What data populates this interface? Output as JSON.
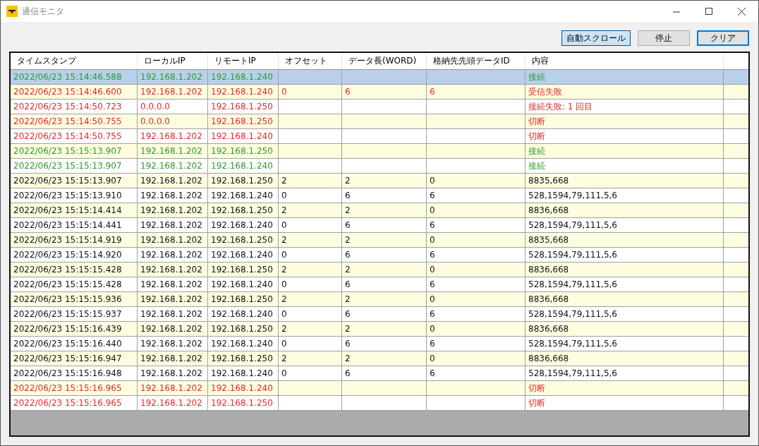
{
  "window": {
    "title": "通信モニタ"
  },
  "buttons": [
    {
      "label": "自動スクロール",
      "pressed": true,
      "focused": false
    },
    {
      "label": "停止",
      "pressed": false,
      "focused": false
    },
    {
      "label": "クリア",
      "pressed": false,
      "focused": true
    }
  ],
  "table": {
    "columns": [
      "タイムスタンプ",
      "ローカルIP",
      "リモートIP",
      "オフセット",
      "データ長(WORD)",
      "格納先先頭データID",
      "内容"
    ],
    "rows": [
      {
        "kind": "connect",
        "selected": true,
        "cells": [
          "2022/06/23 15:14:46.588",
          "192.168.1.202",
          "192.168.1.240",
          null,
          null,
          null,
          "接続"
        ]
      },
      {
        "kind": "error",
        "selected": false,
        "cells": [
          "2022/06/23 15:14:46.600",
          "192.168.1.202",
          "192.168.1.240",
          "0",
          "6",
          "6",
          "受信失敗"
        ]
      },
      {
        "kind": "error",
        "selected": false,
        "cells": [
          "2022/06/23 15:14:50.723",
          "0.0.0.0",
          "192.168.1.250",
          null,
          null,
          null,
          "接続失敗: 1 回目"
        ]
      },
      {
        "kind": "error",
        "selected": false,
        "cells": [
          "2022/06/23 15:14:50.755",
          "0.0.0.0",
          "192.168.1.250",
          null,
          null,
          null,
          "切断"
        ]
      },
      {
        "kind": "error",
        "selected": false,
        "cells": [
          "2022/06/23 15:14:50.755",
          "192.168.1.202",
          "192.168.1.240",
          null,
          null,
          null,
          "切断"
        ]
      },
      {
        "kind": "connect",
        "selected": false,
        "cells": [
          "2022/06/23 15:15:13.907",
          "192.168.1.202",
          "192.168.1.250",
          null,
          null,
          null,
          "接続"
        ]
      },
      {
        "kind": "connect",
        "selected": false,
        "cells": [
          "2022/06/23 15:15:13.907",
          "192.168.1.202",
          "192.168.1.240",
          null,
          null,
          null,
          "接続"
        ]
      },
      {
        "kind": "data",
        "selected": false,
        "cells": [
          "2022/06/23 15:15:13.907",
          "192.168.1.202",
          "192.168.1.250",
          "2",
          "2",
          "0",
          "8835,668"
        ]
      },
      {
        "kind": "data",
        "selected": false,
        "cells": [
          "2022/06/23 15:15:13.910",
          "192.168.1.202",
          "192.168.1.240",
          "0",
          "6",
          "6",
          "528,1594,79,111,5,6"
        ]
      },
      {
        "kind": "data",
        "selected": false,
        "cells": [
          "2022/06/23 15:15:14.414",
          "192.168.1.202",
          "192.168.1.250",
          "2",
          "2",
          "0",
          "8836,668"
        ]
      },
      {
        "kind": "data",
        "selected": false,
        "cells": [
          "2022/06/23 15:15:14.441",
          "192.168.1.202",
          "192.168.1.240",
          "0",
          "6",
          "6",
          "528,1594,79,111,5,6"
        ]
      },
      {
        "kind": "data",
        "selected": false,
        "cells": [
          "2022/06/23 15:15:14.919",
          "192.168.1.202",
          "192.168.1.250",
          "2",
          "2",
          "0",
          "8835,668"
        ]
      },
      {
        "kind": "data",
        "selected": false,
        "cells": [
          "2022/06/23 15:15:14.920",
          "192.168.1.202",
          "192.168.1.240",
          "0",
          "6",
          "6",
          "528,1594,79,111,5,6"
        ]
      },
      {
        "kind": "data",
        "selected": false,
        "cells": [
          "2022/06/23 15:15:15.428",
          "192.168.1.202",
          "192.168.1.250",
          "2",
          "2",
          "0",
          "8836,668"
        ]
      },
      {
        "kind": "data",
        "selected": false,
        "cells": [
          "2022/06/23 15:15:15.428",
          "192.168.1.202",
          "192.168.1.240",
          "0",
          "6",
          "6",
          "528,1594,79,111,5,6"
        ]
      },
      {
        "kind": "data",
        "selected": false,
        "cells": [
          "2022/06/23 15:15:15.936",
          "192.168.1.202",
          "192.168.1.250",
          "2",
          "2",
          "0",
          "8836,668"
        ]
      },
      {
        "kind": "data",
        "selected": false,
        "cells": [
          "2022/06/23 15:15:15.937",
          "192.168.1.202",
          "192.168.1.240",
          "0",
          "6",
          "6",
          "528,1594,79,111,5,6"
        ]
      },
      {
        "kind": "data",
        "selected": false,
        "cells": [
          "2022/06/23 15:15:16.439",
          "192.168.1.202",
          "192.168.1.250",
          "2",
          "2",
          "0",
          "8836,668"
        ]
      },
      {
        "kind": "data",
        "selected": false,
        "cells": [
          "2022/06/23 15:15:16.440",
          "192.168.1.202",
          "192.168.1.240",
          "0",
          "6",
          "6",
          "528,1594,79,111,5,6"
        ]
      },
      {
        "kind": "data",
        "selected": false,
        "cells": [
          "2022/06/23 15:15:16.947",
          "192.168.1.202",
          "192.168.1.250",
          "2",
          "2",
          "0",
          "8836,668"
        ]
      },
      {
        "kind": "data",
        "selected": false,
        "cells": [
          "2022/06/23 15:15:16.948",
          "192.168.1.202",
          "192.168.1.240",
          "0",
          "6",
          "6",
          "528,1594,79,111,5,6"
        ]
      },
      {
        "kind": "error",
        "selected": false,
        "cells": [
          "2022/06/23 15:15:16.965",
          "192.168.1.202",
          "192.168.1.240",
          null,
          null,
          null,
          "切断"
        ]
      },
      {
        "kind": "error",
        "selected": false,
        "cells": [
          "2022/06/23 15:15:16.965",
          "192.168.1.202",
          "192.168.1.250",
          null,
          null,
          null,
          "切断"
        ]
      }
    ]
  }
}
